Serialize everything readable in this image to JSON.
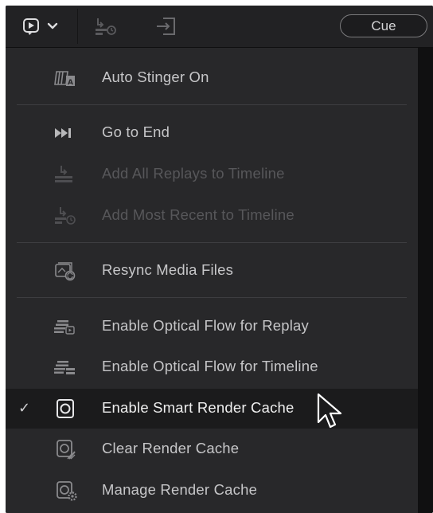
{
  "toolbar": {
    "play_icon": "play-in-window-icon",
    "dropdown_icon": "chevron-down-icon",
    "replay_icon": "add-recent-replay-icon",
    "enter_icon": "enter-icon",
    "cue_label": "Cue"
  },
  "menu": {
    "items": [
      {
        "label": "Auto Stinger On",
        "icon": "auto-stinger-icon",
        "enabled": true,
        "checked": false
      },
      {
        "label": "Go to End",
        "icon": "go-to-end-icon",
        "enabled": true,
        "checked": false
      },
      {
        "label": "Add All Replays to Timeline",
        "icon": "add-all-replays-icon",
        "enabled": false,
        "checked": false
      },
      {
        "label": "Add Most Recent to Timeline",
        "icon": "add-most-recent-icon",
        "enabled": false,
        "checked": false
      },
      {
        "label": "Resync Media Files",
        "icon": "resync-media-icon",
        "enabled": true,
        "checked": false
      },
      {
        "label": "Enable Optical Flow for Replay",
        "icon": "optical-flow-replay-icon",
        "enabled": true,
        "checked": false
      },
      {
        "label": "Enable Optical Flow for Timeline",
        "icon": "optical-flow-timeline-icon",
        "enabled": true,
        "checked": false
      },
      {
        "label": "Enable Smart Render Cache",
        "icon": "smart-render-cache-icon",
        "enabled": true,
        "checked": true
      },
      {
        "label": "Clear Render Cache",
        "icon": "clear-render-cache-icon",
        "enabled": true,
        "checked": false
      },
      {
        "label": "Manage Render Cache",
        "icon": "manage-render-cache-icon",
        "enabled": true,
        "checked": false
      }
    ],
    "check_glyph": "✓"
  },
  "colors": {
    "menu_bg": "#28282a",
    "selected_bg": "#1b1b1c",
    "text": "#c6c6c8",
    "disabled_text": "#57575a"
  }
}
